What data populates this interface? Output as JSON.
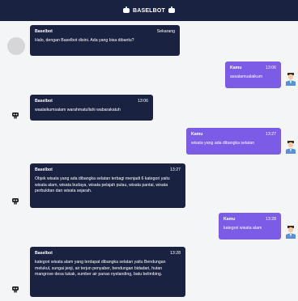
{
  "header": {
    "title": "BASELBOT"
  },
  "messages": [
    {
      "sender": "Baselbot",
      "time": "Sekarang",
      "text": "Halo, dengan Baselbot disini. Ada yang bisa dibantu?"
    },
    {
      "sender": "Kamu",
      "time": "13:06",
      "text": "assalamualaikum"
    },
    {
      "sender": "Baselbot",
      "time": "13:06",
      "text": "waalaikumsalam warahmatullahi wabarakatuh"
    },
    {
      "sender": "Kamu",
      "time": "13:27",
      "text": "wisata yang ada dibangka selatan"
    },
    {
      "sender": "Baselbot",
      "time": "13:27",
      "text": "Objek wisata yang ada dibangka selatan terbagi menjadi 6 kategori yaitu wisata alam, wisata budaya, wisata pelajah pulau, wisata pantai, wisata perbukitan dan wisata sejarah."
    },
    {
      "sender": "Kamu",
      "time": "13:28",
      "text": "kategori wisata alam"
    },
    {
      "sender": "Baselbot",
      "time": "13:28",
      "text": "kategori wisata alam yang terdapat dibangka selatan yaitu Bendungan melukul, sungai jenji, air terjun penyaber, bendungan bidadari, hutan mangrove desa tukak, sumber air panas nyelanding, batu belimbing."
    }
  ],
  "colors": {
    "header_bg": "#1a2242",
    "bot_bubble": "#1a2242",
    "user_bubble": "#7b5ce6",
    "page_bg": "#f4f5f7"
  },
  "icons": {
    "bot": "robot-icon",
    "user": "user-avatar-icon"
  }
}
